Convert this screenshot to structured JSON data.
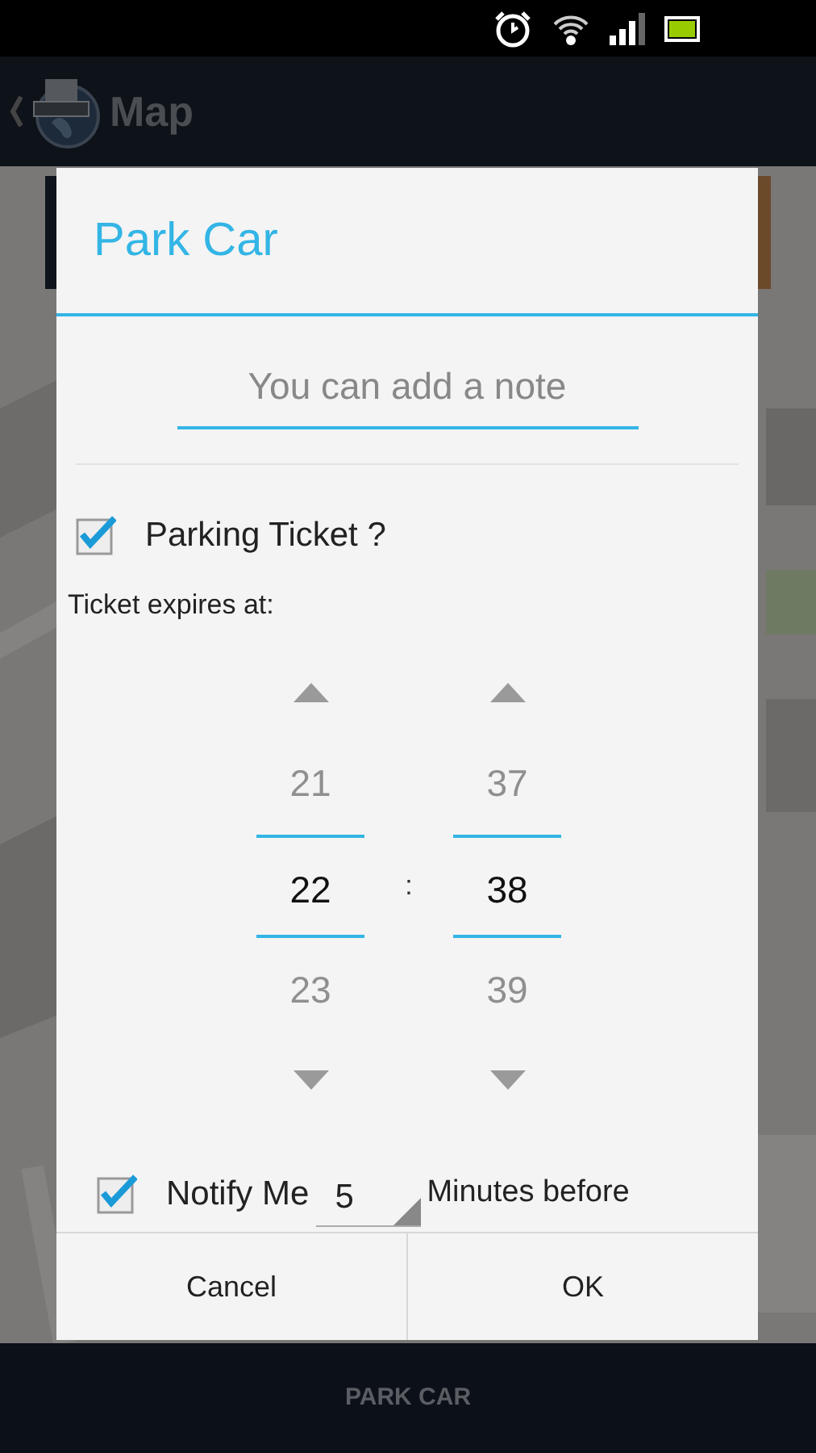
{
  "action_bar": {
    "title": "Map"
  },
  "dialog": {
    "title": "Park Car",
    "note": {
      "placeholder": "You can add a note"
    },
    "parking_ticket": {
      "label": "Parking Ticket ?",
      "checked": true
    },
    "expires_label": "Ticket expires at:",
    "time_picker": {
      "separator": ":",
      "columns": [
        {
          "values": [
            {
              "text": "21",
              "selected": false
            },
            {
              "text": "22",
              "selected": true
            },
            {
              "text": "23",
              "selected": false
            }
          ]
        },
        {
          "values": [
            {
              "text": "37",
              "selected": false
            },
            {
              "text": "38",
              "selected": true
            },
            {
              "text": "39",
              "selected": false
            }
          ]
        }
      ]
    },
    "notify": {
      "label": "Notify Me",
      "checked": true,
      "minutes": "5",
      "suffix": "Minutes before"
    },
    "buttons": [
      {
        "label": "Cancel"
      },
      {
        "label": "OK"
      }
    ]
  },
  "bottom_bar": {
    "button": "PARK CAR"
  }
}
